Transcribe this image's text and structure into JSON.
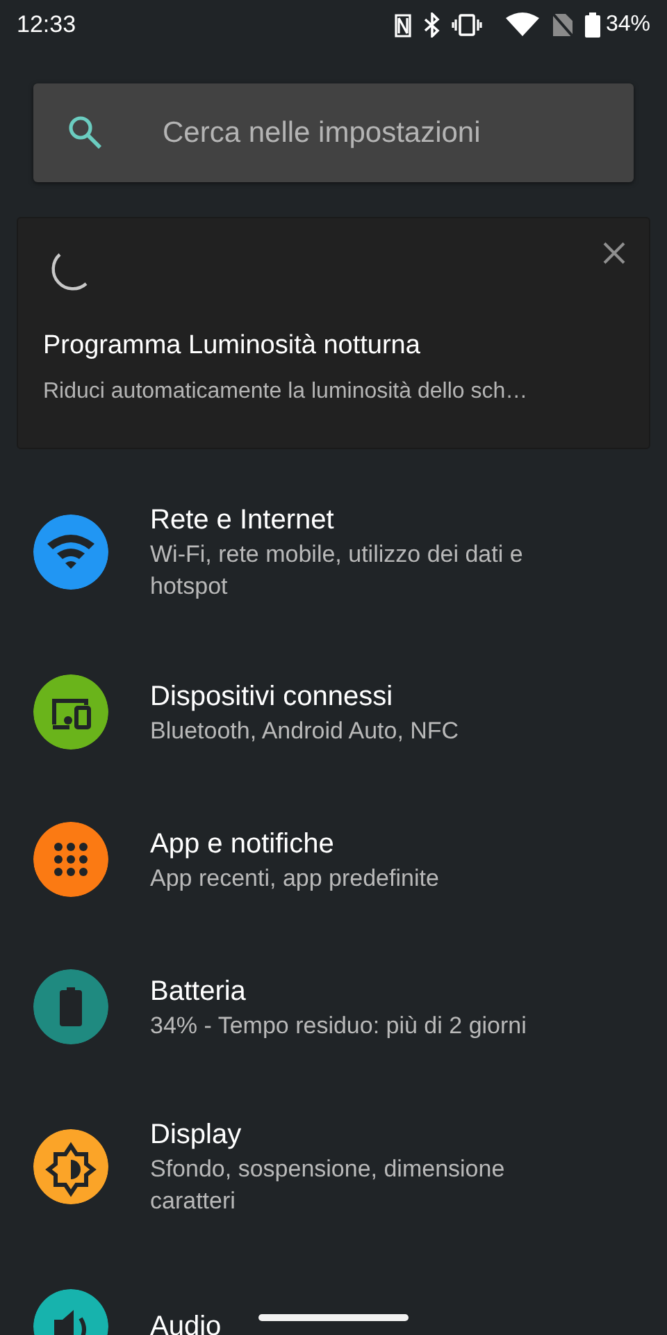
{
  "status_bar": {
    "time": "12:33",
    "battery": "34%"
  },
  "search": {
    "placeholder": "Cerca nelle impostazioni"
  },
  "suggestion": {
    "title": "Programma Luminosità notturna",
    "subtitle": "Riduci automaticamente la luminosità dello sch…"
  },
  "settings": [
    {
      "kind": "network",
      "color": "#2196f3",
      "title": "Rete e Internet",
      "subtitle": "Wi-Fi, rete mobile, utilizzo dei dati e hotspot"
    },
    {
      "kind": "devices",
      "color": "#6ab41b",
      "title": "Dispositivi connessi",
      "subtitle": "Bluetooth, Android Auto, NFC"
    },
    {
      "kind": "apps",
      "color": "#fb7a13",
      "title": "App e notifiche",
      "subtitle": "App recenti, app predefinite"
    },
    {
      "kind": "battery",
      "color": "#1f8a80",
      "title": "Batteria",
      "subtitle": "34% - Tempo residuo: più di 2 giorni"
    },
    {
      "kind": "display",
      "color": "#fba428",
      "title": "Display",
      "subtitle": "Sfondo, sospensione, dimensione caratteri"
    },
    {
      "kind": "audio",
      "color": "#17b3ad",
      "title": "Audio"
    }
  ]
}
